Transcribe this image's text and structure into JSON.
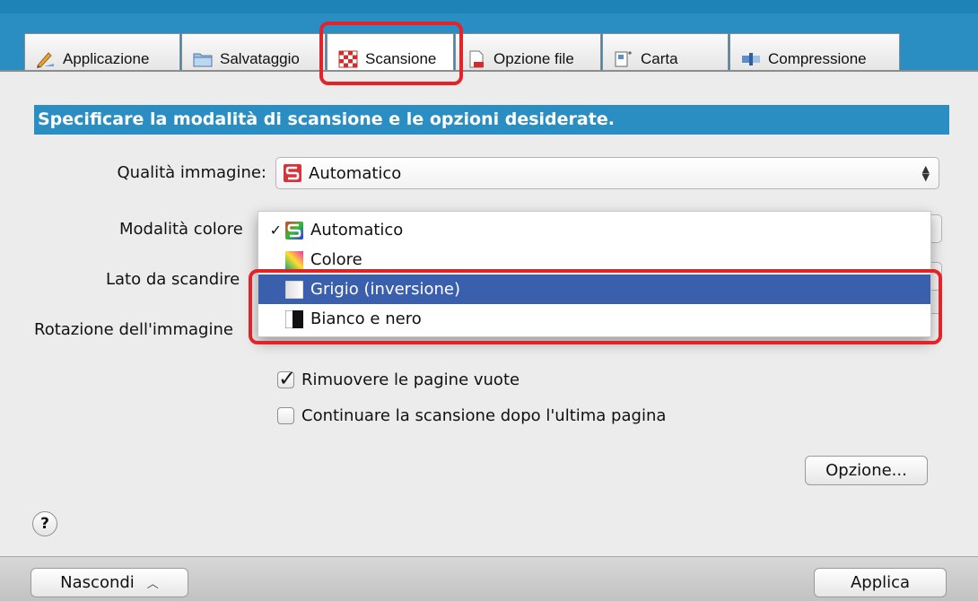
{
  "tabs": [
    {
      "label": "Applicazione",
      "icon": "pencil-ruler-icon"
    },
    {
      "label": "Salvataggio",
      "icon": "folder-icon"
    },
    {
      "label": "Scansione",
      "icon": "checkered-scan-icon"
    },
    {
      "label": "Opzione file",
      "icon": "document-icon"
    },
    {
      "label": "Carta",
      "icon": "paper-size-icon"
    },
    {
      "label": "Compressione",
      "icon": "compress-icon"
    }
  ],
  "active_tab": "Scansione",
  "header": "Specificare la modalità di scansione e le opzioni desiderate.",
  "labels": {
    "image_quality": "Qualità immagine:",
    "color_mode": "Modalità colore",
    "side": "Lato da scandire",
    "rotation": "Rotazione dell'immagine"
  },
  "image_quality_value": "Automatico",
  "color_menu": [
    {
      "label": "Automatico",
      "checked": true,
      "selected": false,
      "icon": "auto-color-icon"
    },
    {
      "label": "Colore",
      "checked": false,
      "selected": false,
      "icon": "color-gradient-icon"
    },
    {
      "label": "Grigio (inversione)",
      "checked": false,
      "selected": true,
      "icon": "gray-gradient-icon"
    },
    {
      "label": "Bianco e nero",
      "checked": false,
      "selected": false,
      "icon": "black-white-icon"
    }
  ],
  "checkboxes": {
    "remove_blank": {
      "label": "Rimuovere le pagine vuote",
      "checked": true
    },
    "continue_scan": {
      "label": "Continuare la scansione dopo l'ultima pagina",
      "checked": false
    }
  },
  "buttons": {
    "option": "Opzione...",
    "hide": "Nascondi",
    "apply": "Applica",
    "help": "?"
  },
  "colors": {
    "accent_blue": "#2a8ec2",
    "highlight_red": "#e3232a",
    "menu_selection": "#3a5fad"
  }
}
